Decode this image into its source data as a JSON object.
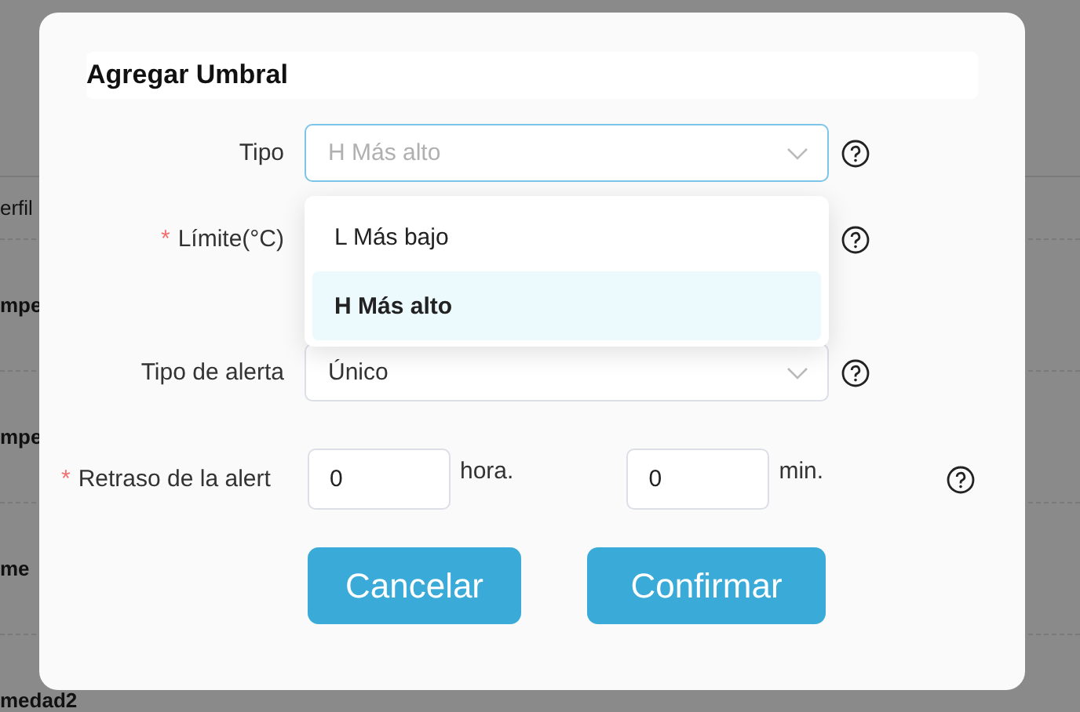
{
  "background_rows": [
    {
      "label": "erfil",
      "bold": false
    },
    {
      "label": "mpe",
      "bold": true
    },
    {
      "label": "mpe",
      "bold": true
    },
    {
      "label": "me",
      "bold": true
    },
    {
      "label": "medad2",
      "bold": true
    }
  ],
  "dialog": {
    "title": "Agregar Umbral",
    "type_field": {
      "label": "Tipo",
      "placeholder": "H Más alto",
      "expanded": true,
      "options": [
        {
          "label": "L Más bajo",
          "selected": false
        },
        {
          "label": "H Más alto",
          "selected": true
        }
      ]
    },
    "limit_field": {
      "label": "Límite(°C)",
      "required": true,
      "required_mark": "*"
    },
    "alert_type_field": {
      "label": "Tipo de alerta",
      "value": "Único"
    },
    "delay_field": {
      "label": "Retraso de la alert",
      "required": true,
      "required_mark": "*",
      "hours": "0",
      "hours_unit": "hora.",
      "minutes": "0",
      "minutes_unit": "min."
    },
    "buttons": [
      "Cancelar",
      "Confirmar"
    ]
  }
}
